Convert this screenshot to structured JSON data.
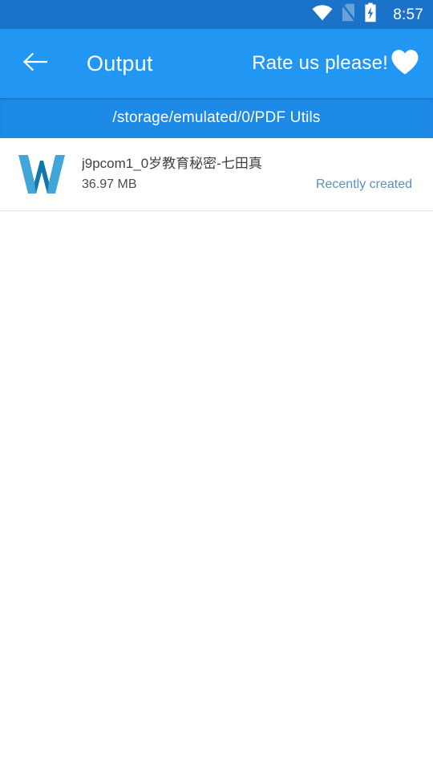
{
  "status_bar": {
    "clock": "8:57",
    "icons": [
      {
        "name": "wifi-icon",
        "label": "wifi-signal-full"
      },
      {
        "name": "sim-card-off-icon",
        "label": "no-sim-card"
      },
      {
        "name": "battery-charging-icon",
        "label": "battery-charging"
      }
    ],
    "background_color": "#1b72c9"
  },
  "app_bar": {
    "back_icon": "arrow-left-icon",
    "title": "Output",
    "rate_label": "Rate us please!",
    "rate_icon": "heart-icon",
    "background_color": "#2196f3",
    "text_color": "#ffffff"
  },
  "path_bar": {
    "path": "/storage/emulated/0/PDF Utils",
    "background_color": "#1d8ae8"
  },
  "file_list": {
    "items": [
      {
        "icon": "word-document-icon",
        "icon_letter": "W",
        "icon_color_light": "#41a5d8",
        "icon_color_dark": "#1277ab",
        "name": "j9pcom1_0岁教育秘密-七田真",
        "size": "36.97 MB",
        "status": "Recently created",
        "status_color": "#5b8fc0"
      }
    ]
  }
}
